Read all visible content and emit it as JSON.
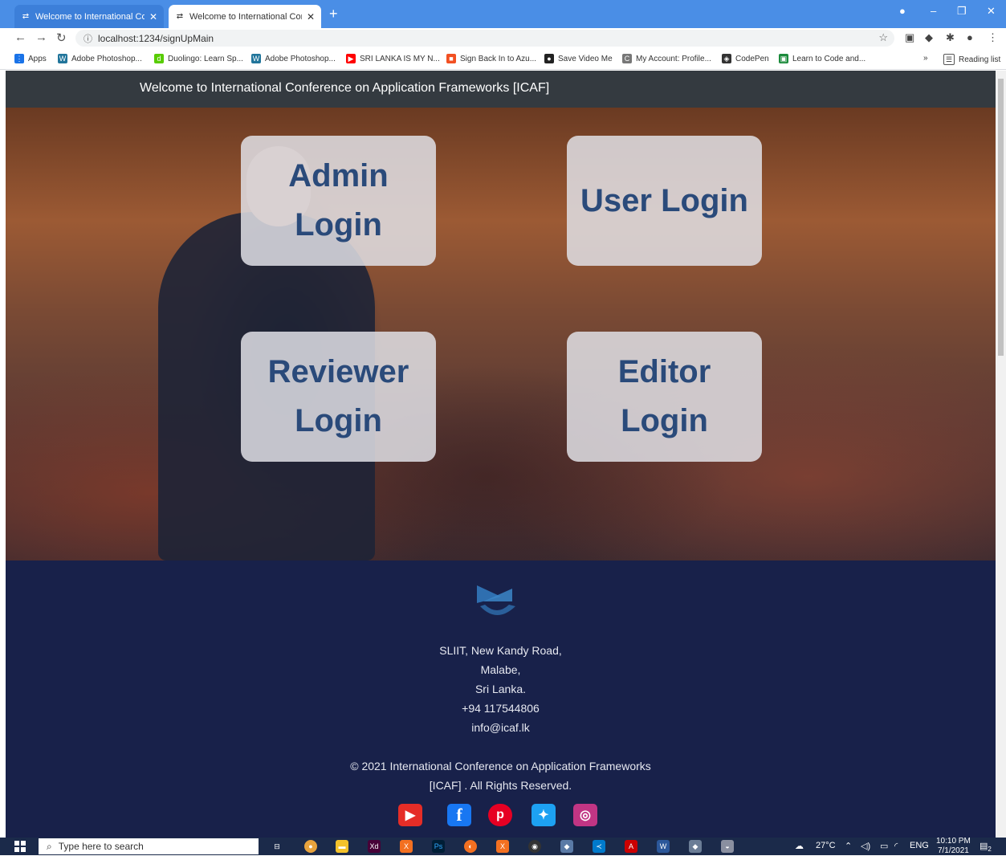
{
  "browser": {
    "tabs": [
      {
        "title": "Welcome to International Confer"
      },
      {
        "title": "Welcome to International Confer"
      }
    ],
    "url": "localhost:1234/signUpMain",
    "bookmarks": [
      "Apps",
      "Adobe Photoshop...",
      "Duolingo: Learn Sp...",
      "Adobe Photoshop...",
      "SRI LANKA IS MY N...",
      "Sign Back In to Azu...",
      "Save Video Me",
      "My Account: Profile...",
      "CodePen",
      "Learn to Code and...",
      "Reading list"
    ]
  },
  "page": {
    "nav_title": "Welcome to International Conference on Application Frameworks [ICAF]",
    "cards": [
      {
        "label": "Admin\nLogin"
      },
      {
        "label": "User Login"
      },
      {
        "label": "Reviewer\nLogin"
      },
      {
        "label": "Editor\nLogin"
      }
    ],
    "footer": {
      "address": [
        "SLIIT, New Kandy Road,",
        "Malabe,",
        "Sri Lanka.",
        "+94 117544806",
        "info@icaf.lk"
      ],
      "copyright_line1": "© 2021 International Conference on Application Frameworks",
      "copyright_line2": "[ICAF] . All Rights Reserved.",
      "social": [
        "youtube-icon",
        "facebook-icon",
        "pinterest-icon",
        "twitter-icon",
        "instagram-icon"
      ]
    }
  },
  "taskbar": {
    "search_placeholder": "Type here to search",
    "weather": "27°C",
    "language": "ENG",
    "time": "10:10 PM",
    "date": "7/1/2021",
    "notification_count": "2"
  },
  "colors": {
    "navbar": "#343a40",
    "card_text": "#2a4a7a",
    "footer_bg": "#18214a",
    "tabbar": "#4a8ee6"
  }
}
